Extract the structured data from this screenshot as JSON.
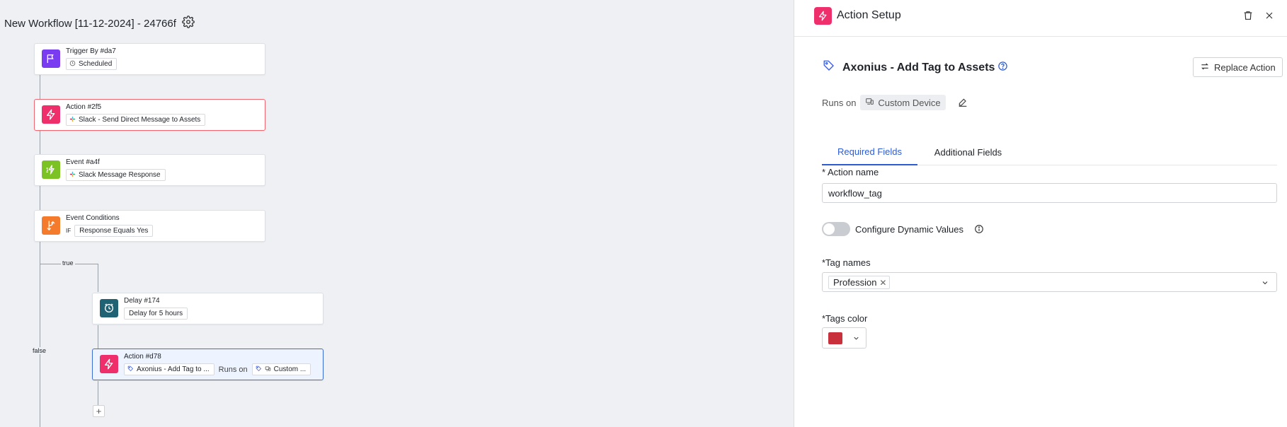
{
  "colors": {
    "trigger": "#7a3cf0",
    "action": "#ee2f6b",
    "event": "#7cc225",
    "conditions": "#f47b2b",
    "delay": "#1f6273",
    "tag_color": "#c8303b",
    "accent": "#2d5bd1"
  },
  "workflow": {
    "title": "New Workflow [11-12-2024] - 24766f",
    "settings_icon": "gear-icon",
    "edges": {
      "true_label": "true",
      "false_label": "false"
    },
    "nodes": [
      {
        "title": "Trigger By #da7",
        "icon": "flag-icon",
        "chip": "Scheduled",
        "chip_icon": "clock-icon"
      },
      {
        "title": "Action #2f5",
        "icon": "bolt-icon",
        "chip": "Slack - Send Direct Message to Assets",
        "chip_icon": "slack-icon",
        "status": "error"
      },
      {
        "title": "Event #a4f",
        "icon": "event-icon",
        "chip": "Slack Message Response",
        "chip_icon": "slack-icon"
      },
      {
        "title": "Event Conditions",
        "icon": "branch-icon",
        "if_label": "IF",
        "chip": "Response Equals Yes"
      },
      {
        "title": "Delay #174",
        "icon": "delay-icon",
        "chip": "Delay for 5 hours"
      },
      {
        "title": "Action #d78",
        "icon": "bolt-icon",
        "chip": "Axonius - Add Tag to ...",
        "chip_icon": "tag-icon",
        "runs_on": "Runs on",
        "chip2": "Custom ...",
        "chip2_icon": "device-icon",
        "status": "selected"
      }
    ],
    "add_button": "+"
  },
  "panel": {
    "title": "Action Setup",
    "action_name": "Axonius - Add Tag to Assets",
    "replace_label": "Replace Action",
    "runs_on_label": "Runs on",
    "device_label": "Custom Device",
    "tabs": [
      "Required Fields",
      "Additional Fields"
    ],
    "active_tab": "Required Fields",
    "fields": {
      "action_name_label": "* Action name",
      "action_name_value": "workflow_tag",
      "toggle_label": "Configure Dynamic Values",
      "toggle_on": false,
      "tag_names_label": "*Tag names",
      "tag_names_selected": [
        "Profession"
      ],
      "tags_color_label": "*Tags color"
    }
  }
}
